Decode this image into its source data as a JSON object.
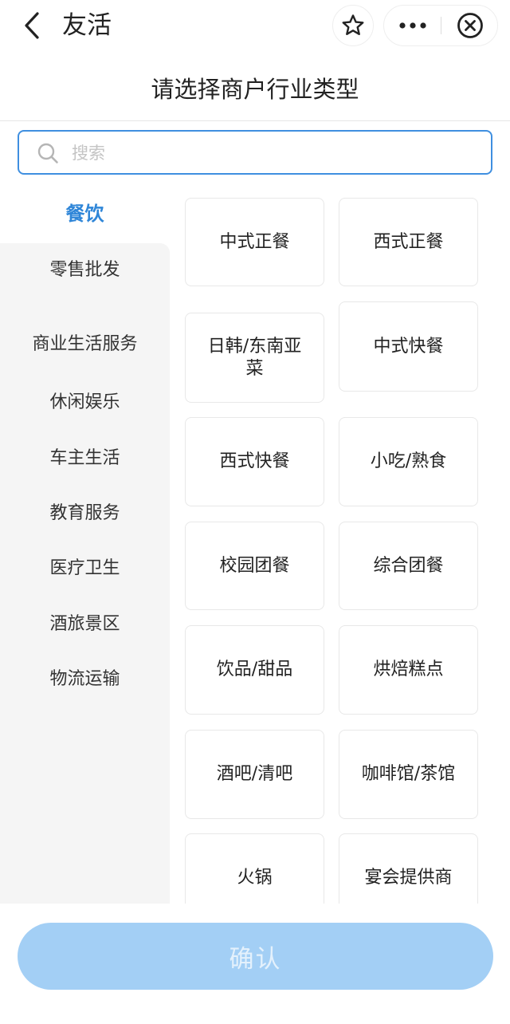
{
  "header": {
    "app_title": "友活",
    "back_icon": "chevron-left-icon",
    "star_icon": "star-icon",
    "more_icon": "more-dots-icon",
    "close_icon": "close-circle-icon"
  },
  "page": {
    "title": "请选择商户行业类型"
  },
  "search": {
    "placeholder": "搜索",
    "value": "",
    "icon": "search-icon",
    "accent_color": "#3f8fe0"
  },
  "categories": {
    "active_color": "#2f86d8",
    "items": [
      {
        "label": "餐饮",
        "active": true
      },
      {
        "label": "零售批发",
        "active": false
      },
      {
        "label": "商业生活服务",
        "active": false
      },
      {
        "label": "休闲娱乐",
        "active": false
      },
      {
        "label": "车主生活",
        "active": false
      },
      {
        "label": "教育服务",
        "active": false
      },
      {
        "label": "医疗卫生",
        "active": false
      },
      {
        "label": "酒旅景区",
        "active": false
      },
      {
        "label": "物流运输",
        "active": false
      }
    ]
  },
  "subcategories": {
    "items": [
      "中式正餐",
      "西式正餐",
      "日韩/东南亚菜",
      "中式快餐",
      "西式快餐",
      "小吃/熟食",
      "校园团餐",
      "综合团餐",
      "饮品/甜品",
      "烘焙糕点",
      "酒吧/清吧",
      "咖啡馆/茶馆",
      "火锅",
      "宴会提供商"
    ]
  },
  "footer": {
    "confirm_label": "确认",
    "confirm_color": "#a3cff5"
  }
}
